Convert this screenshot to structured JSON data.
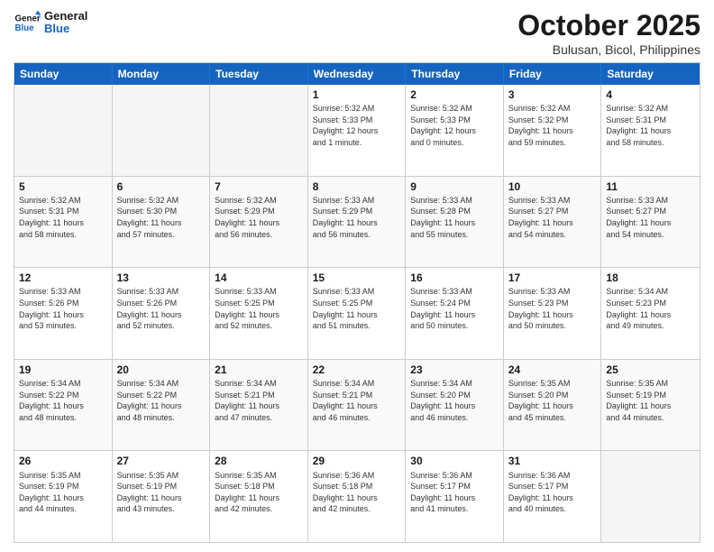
{
  "logo": {
    "text1": "General",
    "text2": "Blue"
  },
  "title": "October 2025",
  "location": "Bulusan, Bicol, Philippines",
  "days": [
    "Sunday",
    "Monday",
    "Tuesday",
    "Wednesday",
    "Thursday",
    "Friday",
    "Saturday"
  ],
  "weeks": [
    [
      {
        "num": "",
        "info": ""
      },
      {
        "num": "",
        "info": ""
      },
      {
        "num": "",
        "info": ""
      },
      {
        "num": "1",
        "info": "Sunrise: 5:32 AM\nSunset: 5:33 PM\nDaylight: 12 hours\nand 1 minute."
      },
      {
        "num": "2",
        "info": "Sunrise: 5:32 AM\nSunset: 5:33 PM\nDaylight: 12 hours\nand 0 minutes."
      },
      {
        "num": "3",
        "info": "Sunrise: 5:32 AM\nSunset: 5:32 PM\nDaylight: 11 hours\nand 59 minutes."
      },
      {
        "num": "4",
        "info": "Sunrise: 5:32 AM\nSunset: 5:31 PM\nDaylight: 11 hours\nand 58 minutes."
      }
    ],
    [
      {
        "num": "5",
        "info": "Sunrise: 5:32 AM\nSunset: 5:31 PM\nDaylight: 11 hours\nand 58 minutes."
      },
      {
        "num": "6",
        "info": "Sunrise: 5:32 AM\nSunset: 5:30 PM\nDaylight: 11 hours\nand 57 minutes."
      },
      {
        "num": "7",
        "info": "Sunrise: 5:32 AM\nSunset: 5:29 PM\nDaylight: 11 hours\nand 56 minutes."
      },
      {
        "num": "8",
        "info": "Sunrise: 5:33 AM\nSunset: 5:29 PM\nDaylight: 11 hours\nand 56 minutes."
      },
      {
        "num": "9",
        "info": "Sunrise: 5:33 AM\nSunset: 5:28 PM\nDaylight: 11 hours\nand 55 minutes."
      },
      {
        "num": "10",
        "info": "Sunrise: 5:33 AM\nSunset: 5:27 PM\nDaylight: 11 hours\nand 54 minutes."
      },
      {
        "num": "11",
        "info": "Sunrise: 5:33 AM\nSunset: 5:27 PM\nDaylight: 11 hours\nand 54 minutes."
      }
    ],
    [
      {
        "num": "12",
        "info": "Sunrise: 5:33 AM\nSunset: 5:26 PM\nDaylight: 11 hours\nand 53 minutes."
      },
      {
        "num": "13",
        "info": "Sunrise: 5:33 AM\nSunset: 5:26 PM\nDaylight: 11 hours\nand 52 minutes."
      },
      {
        "num": "14",
        "info": "Sunrise: 5:33 AM\nSunset: 5:25 PM\nDaylight: 11 hours\nand 52 minutes."
      },
      {
        "num": "15",
        "info": "Sunrise: 5:33 AM\nSunset: 5:25 PM\nDaylight: 11 hours\nand 51 minutes."
      },
      {
        "num": "16",
        "info": "Sunrise: 5:33 AM\nSunset: 5:24 PM\nDaylight: 11 hours\nand 50 minutes."
      },
      {
        "num": "17",
        "info": "Sunrise: 5:33 AM\nSunset: 5:23 PM\nDaylight: 11 hours\nand 50 minutes."
      },
      {
        "num": "18",
        "info": "Sunrise: 5:34 AM\nSunset: 5:23 PM\nDaylight: 11 hours\nand 49 minutes."
      }
    ],
    [
      {
        "num": "19",
        "info": "Sunrise: 5:34 AM\nSunset: 5:22 PM\nDaylight: 11 hours\nand 48 minutes."
      },
      {
        "num": "20",
        "info": "Sunrise: 5:34 AM\nSunset: 5:22 PM\nDaylight: 11 hours\nand 48 minutes."
      },
      {
        "num": "21",
        "info": "Sunrise: 5:34 AM\nSunset: 5:21 PM\nDaylight: 11 hours\nand 47 minutes."
      },
      {
        "num": "22",
        "info": "Sunrise: 5:34 AM\nSunset: 5:21 PM\nDaylight: 11 hours\nand 46 minutes."
      },
      {
        "num": "23",
        "info": "Sunrise: 5:34 AM\nSunset: 5:20 PM\nDaylight: 11 hours\nand 46 minutes."
      },
      {
        "num": "24",
        "info": "Sunrise: 5:35 AM\nSunset: 5:20 PM\nDaylight: 11 hours\nand 45 minutes."
      },
      {
        "num": "25",
        "info": "Sunrise: 5:35 AM\nSunset: 5:19 PM\nDaylight: 11 hours\nand 44 minutes."
      }
    ],
    [
      {
        "num": "26",
        "info": "Sunrise: 5:35 AM\nSunset: 5:19 PM\nDaylight: 11 hours\nand 44 minutes."
      },
      {
        "num": "27",
        "info": "Sunrise: 5:35 AM\nSunset: 5:19 PM\nDaylight: 11 hours\nand 43 minutes."
      },
      {
        "num": "28",
        "info": "Sunrise: 5:35 AM\nSunset: 5:18 PM\nDaylight: 11 hours\nand 42 minutes."
      },
      {
        "num": "29",
        "info": "Sunrise: 5:36 AM\nSunset: 5:18 PM\nDaylight: 11 hours\nand 42 minutes."
      },
      {
        "num": "30",
        "info": "Sunrise: 5:36 AM\nSunset: 5:17 PM\nDaylight: 11 hours\nand 41 minutes."
      },
      {
        "num": "31",
        "info": "Sunrise: 5:36 AM\nSunset: 5:17 PM\nDaylight: 11 hours\nand 40 minutes."
      },
      {
        "num": "",
        "info": ""
      }
    ]
  ]
}
